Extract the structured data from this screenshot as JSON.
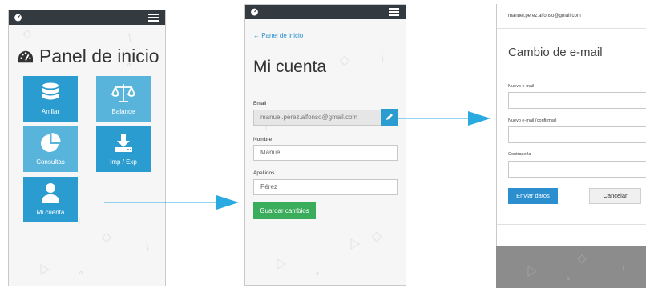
{
  "dashboard": {
    "title": "Panel de inicio",
    "tiles": [
      {
        "label": "Anillar",
        "icon": "database-icon"
      },
      {
        "label": "Balance",
        "icon": "balance-scale-icon"
      },
      {
        "label": "Consultas",
        "icon": "pie-chart-icon"
      },
      {
        "label": "Imp / Exp",
        "icon": "download-icon"
      },
      {
        "label": "Mi cuenta",
        "icon": "user-icon"
      }
    ]
  },
  "account": {
    "back_link": "← Panel de inicio",
    "title": "Mi cuenta",
    "email_label": "Email",
    "email_value": "manuel.perez.alfonso@gmail.com",
    "name_label": "Nombre",
    "name_value": "Manuel",
    "surname_label": "Apellidos",
    "surname_value": "Pérez",
    "save_label": "Guardar cambios"
  },
  "email_modal": {
    "header_email": "manuel.perez.alfonso@gmail.com",
    "title": "Cambio de e-mail",
    "new_email_label": "Nuevo e-mail",
    "confirm_email_label": "Nuevo e-mail (confirmar)",
    "password_label": "Contraseña",
    "submit_label": "Enviar datos",
    "cancel_label": "Cancelar"
  },
  "colors": {
    "accent": "#2b9ccf",
    "arrow": "#29aae1",
    "save": "#3aad5c",
    "topbar": "#333a40"
  }
}
